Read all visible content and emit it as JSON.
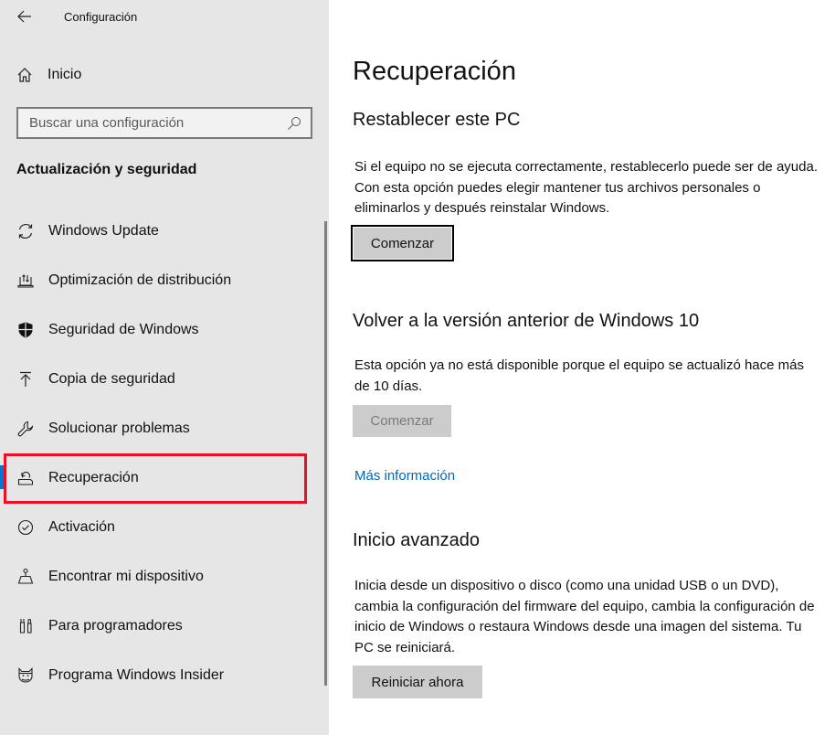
{
  "window": {
    "title": "Configuración"
  },
  "sidebar": {
    "home_label": "Inicio",
    "search": {
      "placeholder": "Buscar una configuración",
      "value": ""
    },
    "section_title": "Actualización y seguridad",
    "selected_index": 5,
    "items": [
      {
        "label": "Windows Update",
        "icon": "sync-icon"
      },
      {
        "label": "Optimización de distribución",
        "icon": "delivery-optimization-icon"
      },
      {
        "label": "Seguridad de Windows",
        "icon": "shield-icon"
      },
      {
        "label": "Copia de seguridad",
        "icon": "backup-upload-icon"
      },
      {
        "label": "Solucionar problemas",
        "icon": "wrench-icon"
      },
      {
        "label": "Recuperación",
        "icon": "recovery-icon"
      },
      {
        "label": "Activación",
        "icon": "check-circle-icon"
      },
      {
        "label": "Encontrar mi dispositivo",
        "icon": "find-device-icon"
      },
      {
        "label": "Para programadores",
        "icon": "developer-tools-icon"
      },
      {
        "label": "Programa Windows Insider",
        "icon": "insider-cat-icon"
      }
    ]
  },
  "main": {
    "title": "Recuperación",
    "reset": {
      "heading": "Restablecer este PC",
      "description": "Si el equipo no se ejecuta correctamente, restablecerlo puede ser de ayuda. Con esta opción puedes elegir mantener tus archivos personales o eliminarlos y después reinstalar Windows.",
      "button": "Comenzar"
    },
    "rollback": {
      "heading": "Volver a la versión anterior de Windows 10",
      "description": "Esta opción ya no está disponible porque el equipo se actualizó hace más de 10 días.",
      "button": "Comenzar",
      "button_disabled": true,
      "link": "Más información"
    },
    "advanced": {
      "heading": "Inicio avanzado",
      "description": "Inicia desde un dispositivo o disco (como una unidad USB o un DVD), cambia la configuración del firmware del equipo, cambia la configuración de inicio de Windows o restaura Windows desde una imagen del sistema. Tu PC se reiniciará.",
      "button": "Reiniciar ahora"
    }
  },
  "colors": {
    "sidebar_bg": "#e6e6e6",
    "accent": "#0078d7",
    "link": "#0067b8",
    "highlight": "#e81123",
    "button_bg": "#cccccc"
  }
}
